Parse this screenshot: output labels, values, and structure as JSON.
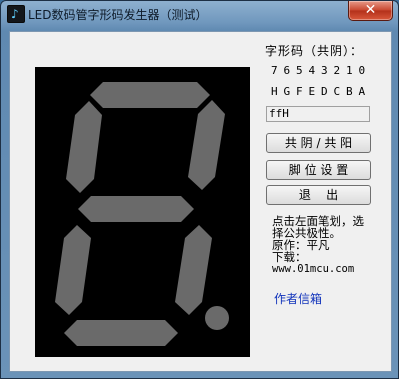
{
  "window": {
    "title": "LED数码管字形码发生器（测试）",
    "close_glyph": "✕",
    "app_icon_glyph": "♪"
  },
  "panel": {
    "code_title": "字形码（共阴）：",
    "bit_numbers": [
      "7",
      "6",
      "5",
      "4",
      "3",
      "2",
      "1",
      "0"
    ],
    "bit_letters": [
      "H",
      "G",
      "F",
      "E",
      "D",
      "C",
      "B",
      "A"
    ],
    "code_value": "ffH"
  },
  "buttons": {
    "common": "共 阴 / 共 阳",
    "pins": "脚 位 设 置",
    "exit": "退    出"
  },
  "description": {
    "line1": "点击左面笔划，选",
    "line2": "择公共极性。",
    "line3": "原作：平凡",
    "line4": "下载：",
    "url": "www.01mcu.com"
  },
  "author_link": "作者信箱",
  "segments_lit": {
    "A": true,
    "B": true,
    "C": true,
    "D": true,
    "E": true,
    "F": true,
    "G": true,
    "DP": true
  },
  "colors": {
    "segment": "#6a6a6a",
    "display_bg": "#000000",
    "link": "#1133bb"
  }
}
